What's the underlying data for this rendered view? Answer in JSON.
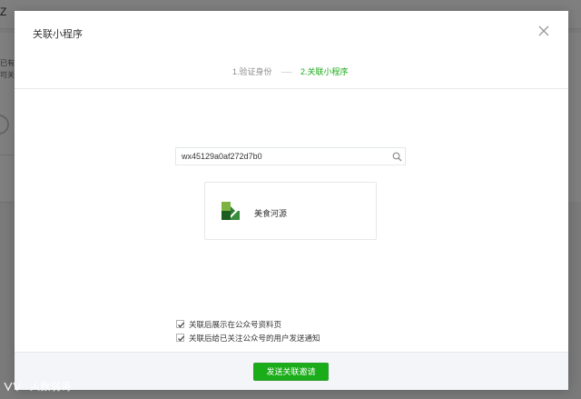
{
  "background_page": {
    "header_fragment": "Z",
    "fragments": [
      "已有白",
      "可关联"
    ]
  },
  "dialog": {
    "title": "关联小程序",
    "steps": [
      {
        "label": "1.验证身份",
        "active": false
      },
      {
        "label": "2.关联小程序",
        "active": true
      }
    ],
    "search": {
      "value": "wx45129a0af272d7b0",
      "icon": "search-icon"
    },
    "result": {
      "name": "美食河源",
      "icon": "mini-program-logo"
    },
    "options": [
      {
        "label": "关联后展示在公众号资料页",
        "checked": true
      },
      {
        "label": "关联后给已关注公众号的用户发送通知",
        "checked": true
      }
    ],
    "submit_label": "发送关联邀请"
  },
  "watermark": {
    "text": "人数弱哥"
  },
  "colors": {
    "accent": "#1aad19",
    "muted_text": "#8d8d8d",
    "text": "#353535"
  }
}
